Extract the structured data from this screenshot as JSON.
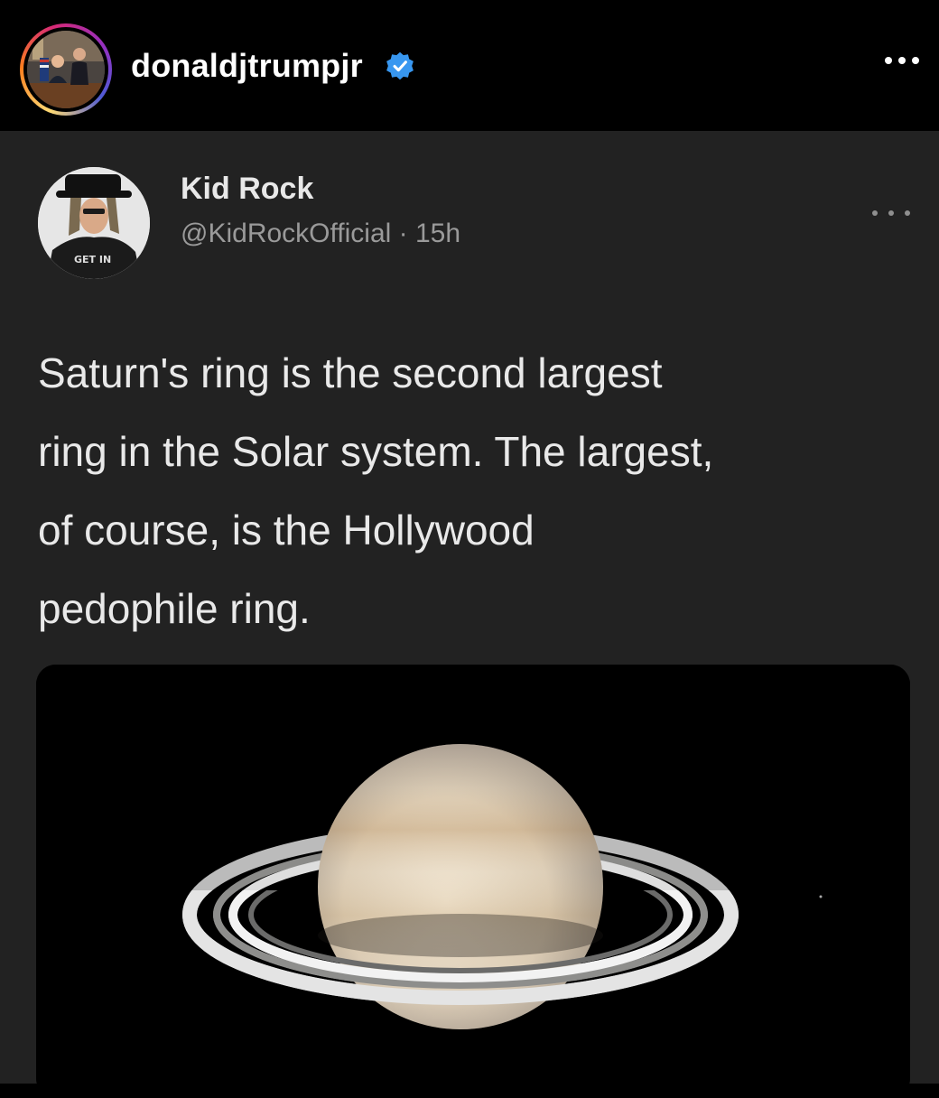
{
  "instagram": {
    "username": "donaldjtrumpjr",
    "verified": true,
    "more_icon": "more-horizontal-icon",
    "verified_icon": "verified-badge-icon"
  },
  "tweet": {
    "author_name": "Kid Rock",
    "handle": "@KidRockOfficial",
    "time": "15h",
    "text_lines": [
      "Saturn's ring is the second largest",
      "ring in the Solar system. The largest,",
      "of course, is the Hollywood",
      "pedophile ring."
    ],
    "media_subject": "Saturn with rings",
    "avatar_shirt_text": "GET IN"
  },
  "colors": {
    "background": "#000000",
    "card": "#222222",
    "verified_blue": "#3897f0",
    "muted_text": "#9a9a9a"
  }
}
